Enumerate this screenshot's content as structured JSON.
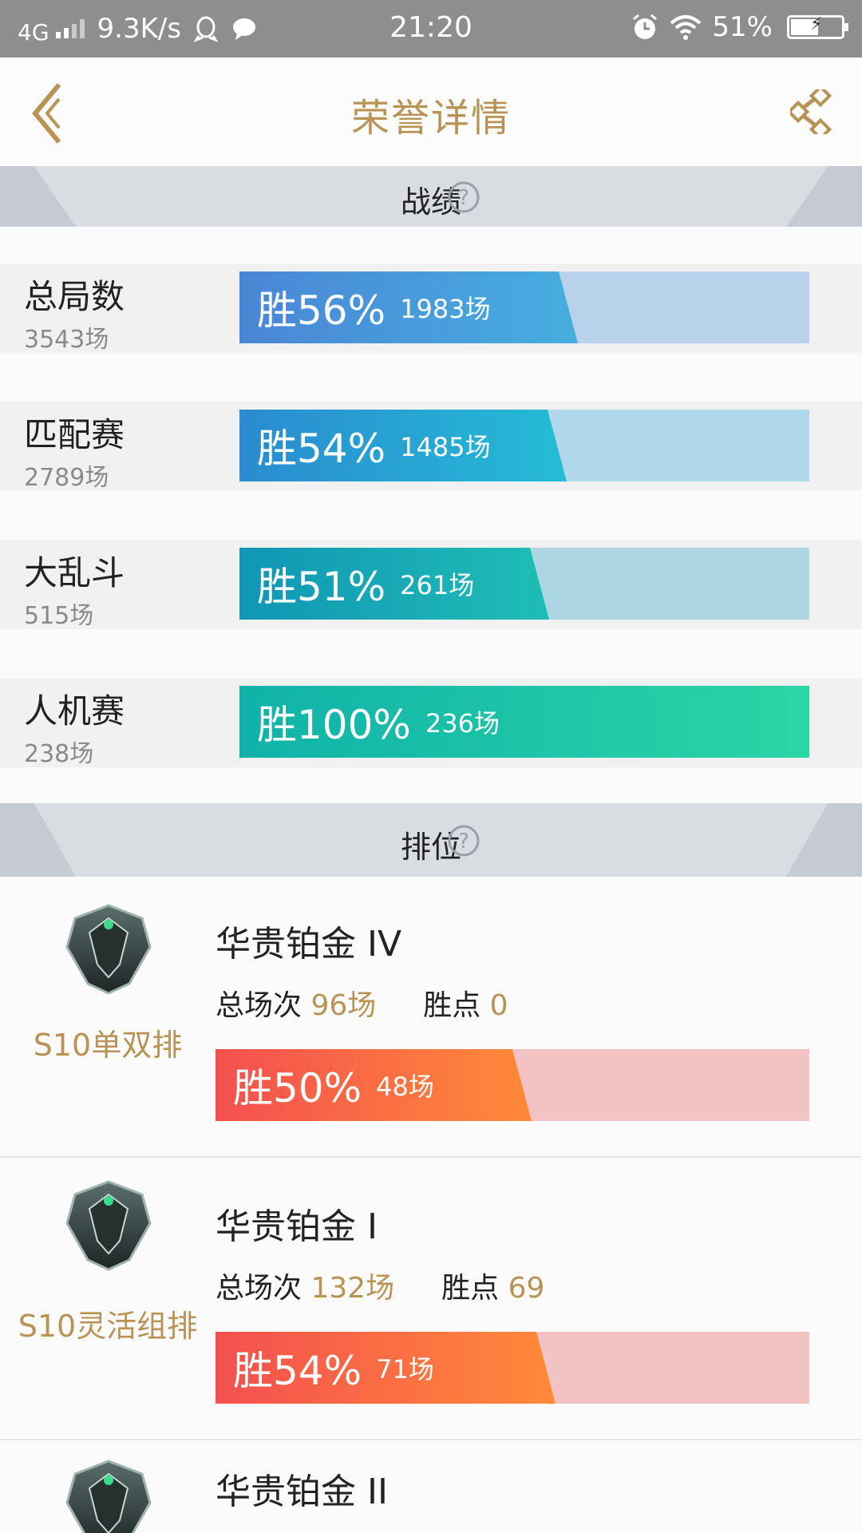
{
  "status_bar": {
    "network": "4G",
    "speed": "9.3K/s",
    "time": "21:20",
    "battery": "51%"
  },
  "header": {
    "title": "荣誉详情",
    "back_icon": "chevron-left-icon",
    "share_icon": "share-icon"
  },
  "record_section": {
    "title": "战绩",
    "help_icon": "question-icon"
  },
  "stats": [
    {
      "name": "总局数",
      "count": "3543场",
      "win_label": "胜56%",
      "win_games": "1983场",
      "win_fraction": 0.56,
      "fill_color": "#46aedf",
      "bg_color": "#b9d2ec"
    },
    {
      "name": "匹配赛",
      "count": "2789场",
      "win_label": "胜54%",
      "win_games": "1485场",
      "win_fraction": 0.54,
      "fill_color": "#25bcd6",
      "bg_color": "#b0d8ea"
    },
    {
      "name": "大乱斗",
      "count": "515场",
      "win_label": "胜51%",
      "win_games": "261场",
      "win_fraction": 0.51,
      "fill_color": "#1fbdb5",
      "bg_color": "#acd7e2"
    },
    {
      "name": "人机赛",
      "count": "238场",
      "win_label": "胜100%",
      "win_games": "236场",
      "win_fraction": 1.0,
      "fill_color": "#2bd6a6",
      "bg_color": "#a8e3d5"
    }
  ],
  "rank_section": {
    "title": "排位",
    "help_icon": "question-icon"
  },
  "ranks": [
    {
      "mode": "S10单双排",
      "tier": "华贵铂金 IV",
      "total_label": "总场次",
      "total": "96场",
      "points_label": "胜点",
      "points": "0",
      "win_label": "胜50%",
      "win_games": "48场",
      "win_fraction": 0.5
    },
    {
      "mode": "S10灵活组排",
      "tier": "华贵铂金 I",
      "total_label": "总场次",
      "total": "132场",
      "points_label": "胜点",
      "points": "69",
      "win_label": "胜54%",
      "win_games": "71场",
      "win_fraction": 0.54
    },
    {
      "mode": "",
      "tier": "华贵铂金 II",
      "total_label": "",
      "total": "",
      "points_label": "",
      "points": "",
      "win_label": "",
      "win_games": "",
      "win_fraction": 0
    }
  ],
  "colors": {
    "accent_gold": "#b89355",
    "rank_bar_fill_start": "#f4504f",
    "rank_bar_fill_end": "#ff8a38",
    "rank_bar_bg": "#f3c3c3"
  }
}
